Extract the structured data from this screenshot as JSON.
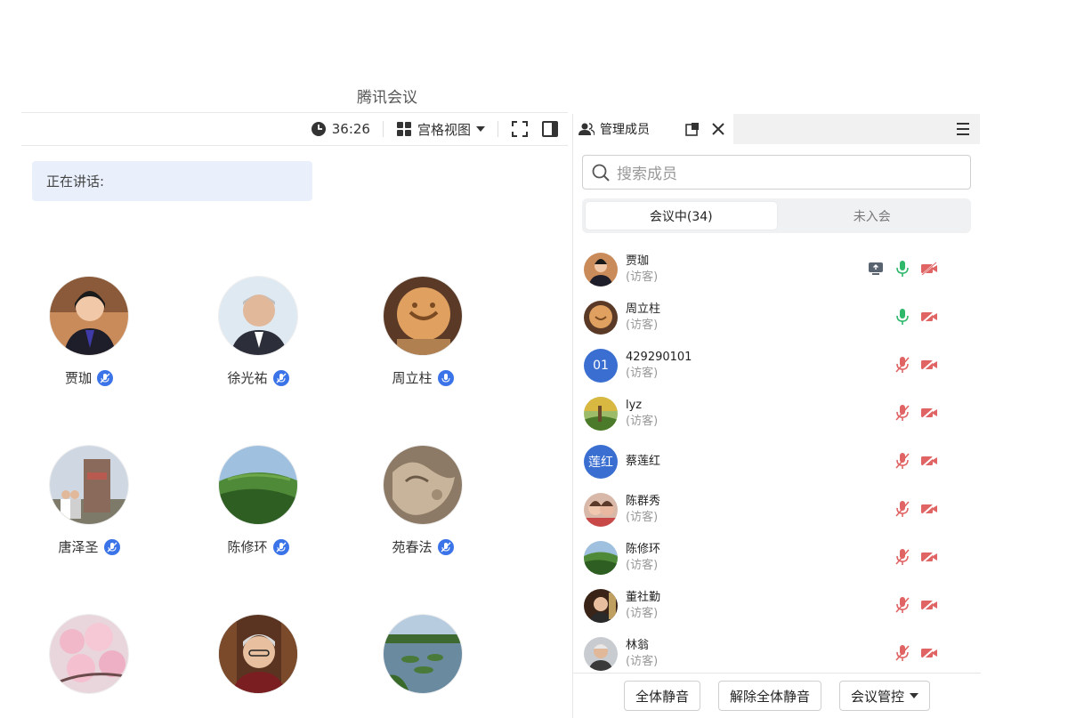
{
  "app": {
    "title": "腾讯会议"
  },
  "toolbar": {
    "timer": "36:26",
    "view_label": "宫格视图"
  },
  "speaking": {
    "label": "正在讲话:"
  },
  "grid": {
    "tiles": [
      {
        "name": "贾珈",
        "avatar": "woman-portrait",
        "mic": "muted-mic"
      },
      {
        "name": "徐光祐",
        "avatar": "man-portrait",
        "mic": "muted-mic"
      },
      {
        "name": "周立柱",
        "avatar": "wood-carving",
        "mic": "mic"
      },
      {
        "name": "唐泽圣",
        "avatar": "monument-photo",
        "mic": "muted-mic"
      },
      {
        "name": "陈修环",
        "avatar": "landscape-hills",
        "mic": "muted-mic"
      },
      {
        "name": "苑春法",
        "avatar": "stone-texture",
        "mic": "muted-mic"
      },
      {
        "name": "",
        "avatar": "cherry-blossom",
        "mic": ""
      },
      {
        "name": "",
        "avatar": "elder-with-bookshelf",
        "mic": ""
      },
      {
        "name": "",
        "avatar": "lotus-pond",
        "mic": ""
      }
    ]
  },
  "panel": {
    "tab_label": "管理成员",
    "search_placeholder": "搜索成员",
    "segments": {
      "in_meeting": "会议中(34)",
      "not_joined": "未入会"
    },
    "members": [
      {
        "name": "贾珈",
        "role": "(访客)",
        "avatar": "photo",
        "avatar_text": "",
        "share": true,
        "mic_on": true
      },
      {
        "name": "周立柱",
        "role": "(访客)",
        "avatar": "photo",
        "avatar_text": "",
        "share": false,
        "mic_on": true
      },
      {
        "name": "429290101",
        "role": "(访客)",
        "avatar": "text",
        "avatar_text": "01",
        "share": false,
        "mic_on": false
      },
      {
        "name": "lyz",
        "role": "(访客)",
        "avatar": "photo",
        "avatar_text": "",
        "share": false,
        "mic_on": false
      },
      {
        "name": "蔡莲红",
        "role": "",
        "avatar": "text",
        "avatar_text": "莲红",
        "share": false,
        "mic_on": false
      },
      {
        "name": "陈群秀",
        "role": "(访客)",
        "avatar": "photo",
        "avatar_text": "",
        "share": false,
        "mic_on": false
      },
      {
        "name": "陈修环",
        "role": "(访客)",
        "avatar": "photo",
        "avatar_text": "",
        "share": false,
        "mic_on": false
      },
      {
        "name": "董社勤",
        "role": "(访客)",
        "avatar": "photo",
        "avatar_text": "",
        "share": false,
        "mic_on": false
      },
      {
        "name": "林翁",
        "role": "(访客)",
        "avatar": "photo",
        "avatar_text": "",
        "share": false,
        "mic_on": false
      }
    ],
    "footer": {
      "mute_all": "全体静音",
      "unmute_all": "解除全体静音",
      "control": "会议管控"
    }
  },
  "colors": {
    "accent": "#3b74e8",
    "mic_on": "#2fb76a",
    "muted": "#e06464"
  }
}
